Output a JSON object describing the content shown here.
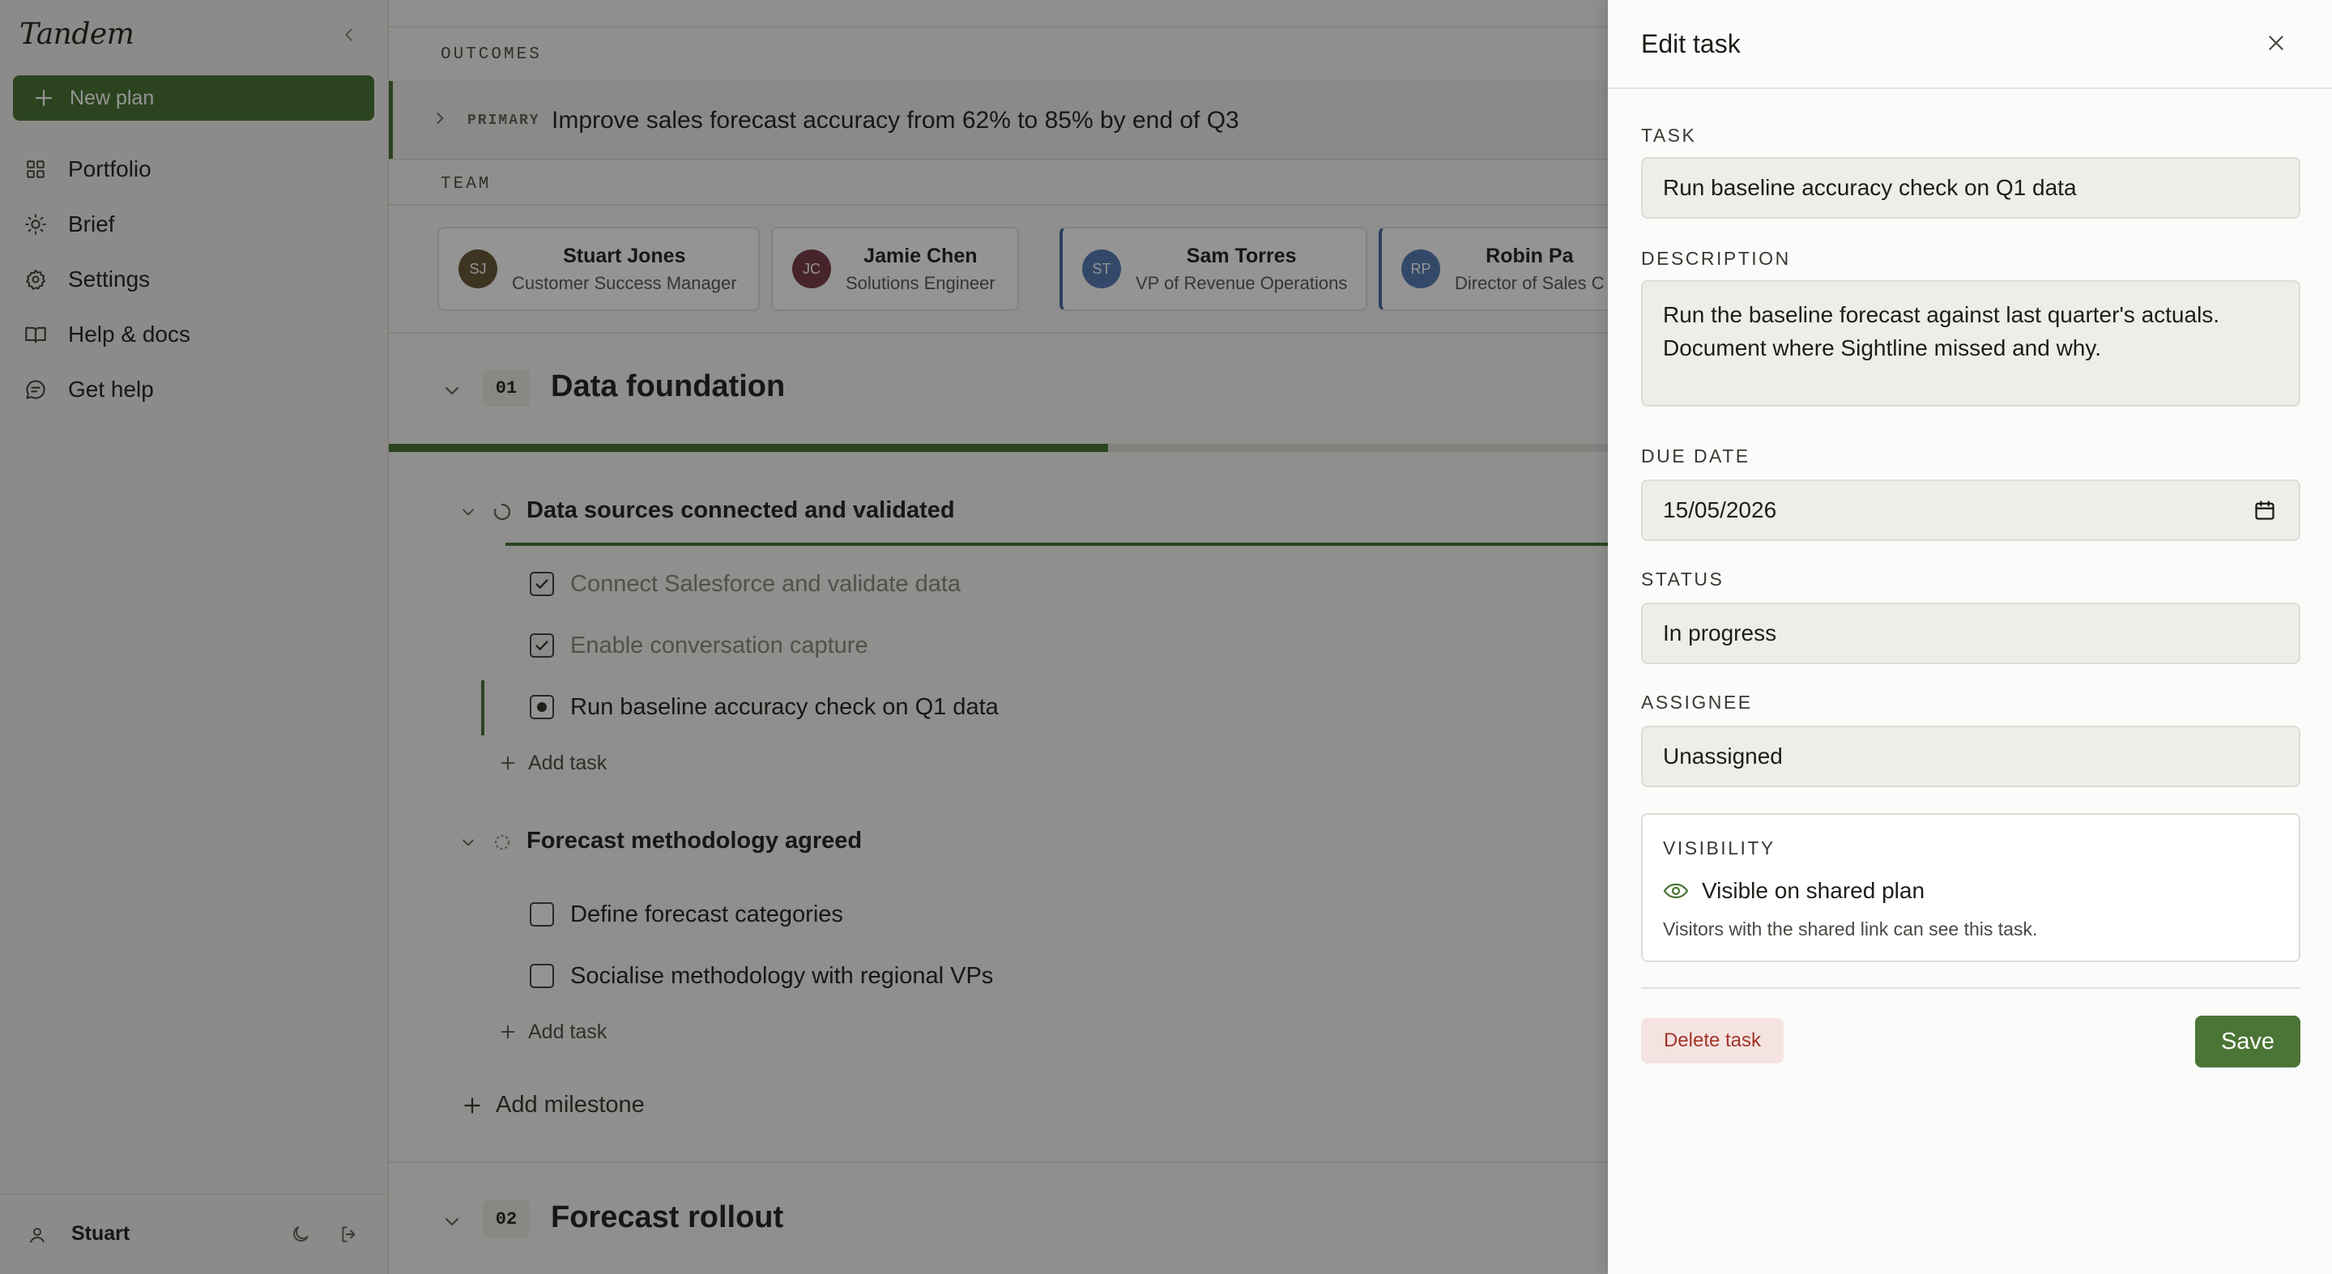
{
  "app": {
    "brand": "Tandem"
  },
  "sidebar": {
    "new_plan_label": "New plan",
    "items": [
      {
        "label": "Portfolio",
        "icon": "grid-icon"
      },
      {
        "label": "Brief",
        "icon": "sun-icon"
      },
      {
        "label": "Settings",
        "icon": "gear-icon"
      },
      {
        "label": "Help & docs",
        "icon": "book-icon"
      },
      {
        "label": "Get help",
        "icon": "chat-icon"
      }
    ],
    "user_name": "Stuart"
  },
  "main": {
    "outcomes_label": "OUTCOMES",
    "outcome": {
      "tag": "PRIMARY",
      "text": "Improve sales forecast accuracy from 62% to 85% by end of Q3"
    },
    "team_label": "TEAM",
    "team": [
      {
        "initials": "SJ",
        "name": "Stuart Jones",
        "role": "Customer Success Manager",
        "color": "#6b5a3c"
      },
      {
        "initials": "JC",
        "name": "Jamie Chen",
        "role": "Solutions Engineer",
        "color": "#7a3e4a"
      },
      {
        "initials": "ST",
        "name": "Sam Torres",
        "role": "VP of Revenue Operations",
        "color": "#5a7fb5"
      },
      {
        "initials": "RP",
        "name": "Robin Pa",
        "role": "Director of Sales C",
        "color": "#5a7fb5"
      }
    ],
    "phases": [
      {
        "number": "01",
        "title": "Data foundation",
        "progress": 0.37,
        "milestones": [
          {
            "title": "Data sources connected and validated",
            "tasks": [
              {
                "label": "Connect Salesforce and validate data",
                "state": "done"
              },
              {
                "label": "Enable conversation capture",
                "state": "done"
              },
              {
                "label": "Run baseline accuracy check on Q1 data",
                "state": "in-progress"
              }
            ],
            "add_task_label": "Add task"
          },
          {
            "title": "Forecast methodology agreed",
            "tasks": [
              {
                "label": "Define forecast categories",
                "state": "todo"
              },
              {
                "label": "Socialise methodology with regional VPs",
                "state": "todo"
              }
            ],
            "add_task_label": "Add task"
          }
        ],
        "add_milestone_label": "Add milestone"
      },
      {
        "number": "02",
        "title": "Forecast rollout"
      }
    ]
  },
  "drawer": {
    "title": "Edit task",
    "task_label": "TASK",
    "task_value": "Run baseline accuracy check on Q1 data",
    "description_label": "DESCRIPTION",
    "description_value": "Run the baseline forecast against last quarter's actuals. Document where Sightline missed and why.",
    "due_date_label": "DUE DATE",
    "due_date_value": "15/05/2026",
    "status_label": "STATUS",
    "status_value": "In progress",
    "assignee_label": "ASSIGNEE",
    "assignee_value": "Unassigned",
    "visibility_label": "VISIBILITY",
    "visibility_value": "Visible on shared plan",
    "visibility_note": "Visitors with the shared link can see this task.",
    "delete_label": "Delete task",
    "save_label": "Save"
  },
  "colors": {
    "accent": "#4b7536",
    "danger": "#a2342a",
    "overlay": "rgba(0,0,0,0.42)"
  }
}
